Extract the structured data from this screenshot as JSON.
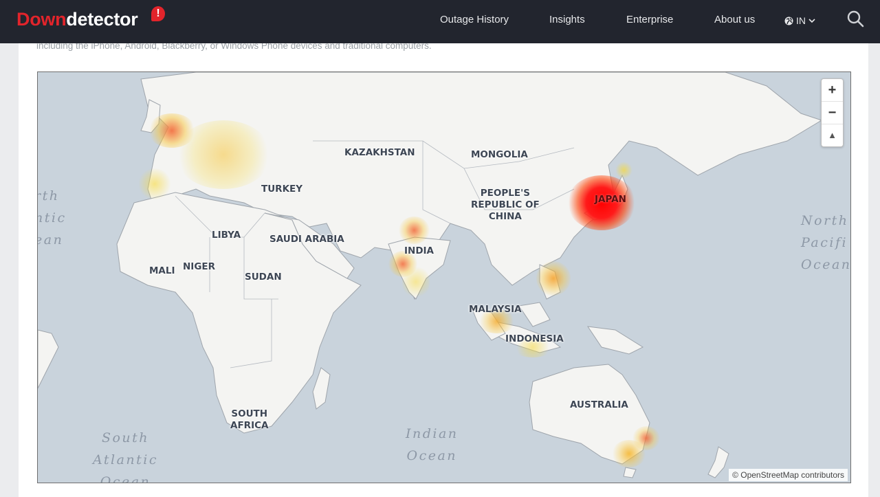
{
  "header": {
    "logo_a": "Down",
    "logo_b": "detector",
    "logo_badge": "!",
    "nav": [
      "Outage History",
      "Insights",
      "Enterprise",
      "About us"
    ],
    "region": "IN",
    "icons": [
      "globe-icon",
      "chevron-down-icon",
      "search-icon"
    ]
  },
  "intro_text": "including the iPhone, Android, Blackberry, or Windows Phone devices and traditional computers.",
  "map": {
    "countries": {
      "kazakhstan": "KAZAKHSTAN",
      "mongolia": "MONGOLIA",
      "turkey": "TURKEY",
      "china": "PEOPLE'S\nREPUBLIC OF\nCHINA",
      "japan": "JAPAN",
      "libya": "LIBYA",
      "saudi": "SAUDI ARABIA",
      "india": "INDIA",
      "mali": "MALI",
      "niger": "NIGER",
      "sudan": "SUDAN",
      "malaysia": "MALAYSIA",
      "indonesia": "INDONESIA",
      "australia": "AUSTRALIA",
      "south_africa": "SOUTH\nAFRICA"
    },
    "oceans": {
      "north_atlantic": "rth\nntic\nean",
      "north_pacific": "North\nPacifi\nOcean",
      "south_atlantic": "South\nAtlantic\nOcean",
      "indian": "Indian\nOcean"
    },
    "zoom_in": "+",
    "zoom_out": "−",
    "reset": "▲",
    "attribution": "© OpenStreetMap contributors",
    "hotspot_colors": {
      "high": "#ff0000",
      "medium": "#f26a3a",
      "low": "#f7c53a"
    }
  }
}
